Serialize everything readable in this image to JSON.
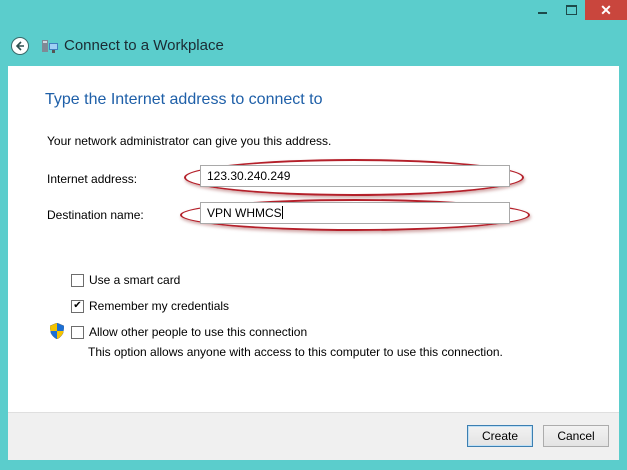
{
  "window": {
    "title": "Connect to a Workplace",
    "controls": {
      "minimize": "",
      "maximize": "",
      "close": "✕"
    }
  },
  "page": {
    "heading": "Type the Internet address to connect to",
    "info": "Your network administrator can give you this address.",
    "internet_address": {
      "label": "Internet address:",
      "value": "123.30.240.249"
    },
    "destination_name": {
      "label": "Destination name:",
      "value": "VPN WHMCS"
    }
  },
  "options": {
    "smart_card": {
      "label": "Use a smart card",
      "checked": false
    },
    "remember": {
      "label": "Remember my credentials",
      "checked": true
    },
    "allow_others": {
      "label": "Allow other people to use this connection",
      "checked": false
    },
    "allow_hint": "This option allows anyone with access to this computer to use this connection."
  },
  "footer": {
    "create_label": "Create",
    "cancel_label": "Cancel"
  },
  "icons": {
    "back": "back-arrow-icon",
    "app": "network-workplace-icon",
    "shield": "uac-shield-icon",
    "check": "✔"
  },
  "colors": {
    "frame": "#5bcdcc",
    "heading": "#1e5fa8",
    "highlight_oval": "#b4202a",
    "close": "#c9463d"
  }
}
